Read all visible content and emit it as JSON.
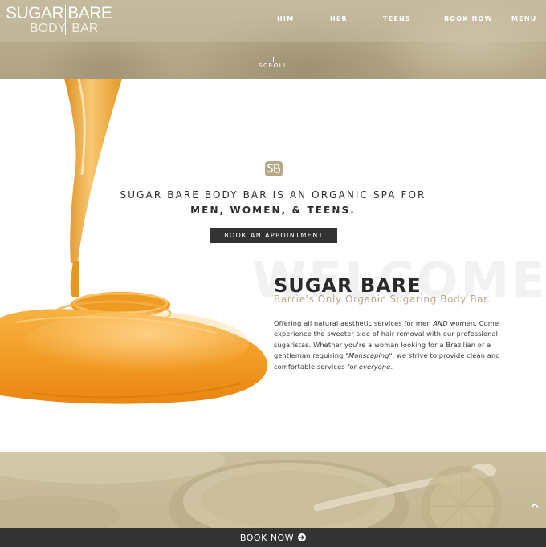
{
  "logo": {
    "word1": "SUGAR",
    "word2": "BARE",
    "word3": "BODY",
    "word4": "BAR"
  },
  "nav": {
    "him": "HIM",
    "her": "HER",
    "teens": "TEENS",
    "book_now": "BOOK NOW",
    "menu": "MENU"
  },
  "hero": {
    "scroll_label": "SCROLL"
  },
  "intro": {
    "tagline_line1": "SUGAR BARE BODY BAR IS AN ORGANIC SPA FOR",
    "tagline_line2": "MEN, WOMEN, & TEENS.",
    "cta_label": "BOOK AN APPOINTMENT",
    "watermark": "WELCOME",
    "title": "SUGAR BARE",
    "subtitle": "Barrie's Only Organic Sugaring Body Bar.",
    "body": {
      "p1": "Offering all natural aesthetic services for men ",
      "p2": "AND",
      "p3": " women. Come experience the sweeter side of hair removal with our professional sugaristas. Whether you're a woman looking for a Brazilian or a gentleman requiring \"",
      "p4": "Manscaping",
      "p5": "\", we strive to provide clean and comfortable services for ",
      "p6": "everyone",
      "p7": "."
    }
  },
  "footer": {
    "book_now_label": "BOOK NOW"
  },
  "icons": {
    "logo_mark": "sb-monogram-icon",
    "book_arrow": "arrow-circle-right-icon",
    "back_to_top": "chevron-up-icon"
  },
  "colors": {
    "accent": "#b6a98a",
    "dark": "#333333",
    "honey": "#f2a12a"
  }
}
